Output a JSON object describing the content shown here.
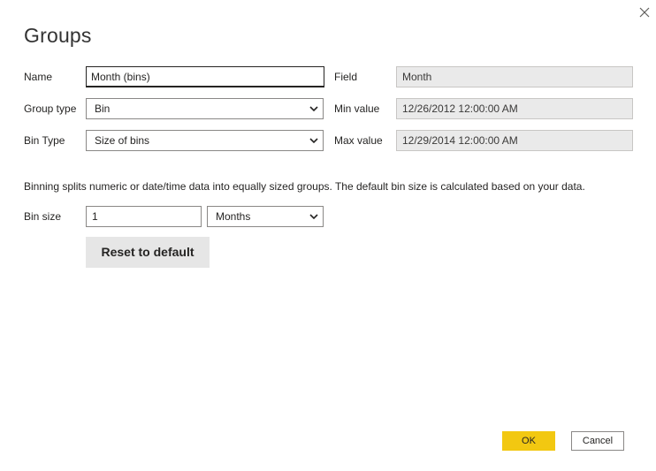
{
  "dialog": {
    "title": "Groups",
    "close_icon": "close-icon"
  },
  "form": {
    "name_label": "Name",
    "name_value": "Month (bins)",
    "group_type_label": "Group type",
    "group_type_value": "Bin",
    "bin_type_label": "Bin Type",
    "bin_type_value": "Size of bins",
    "field_label": "Field",
    "field_value": "Month",
    "min_label": "Min value",
    "min_value": "12/26/2012 12:00:00 AM",
    "max_label": "Max value",
    "max_value": "12/29/2014 12:00:00 AM"
  },
  "binning": {
    "hint": "Binning splits numeric or date/time data into equally sized groups. The default bin size is calculated based on your data.",
    "bin_size_label": "Bin size",
    "bin_size_value": "1",
    "bin_unit_value": "Months",
    "reset_label": "Reset to default"
  },
  "footer": {
    "ok_label": "OK",
    "cancel_label": "Cancel"
  },
  "colors": {
    "accent": "#f2c811",
    "readonly_bg": "#eaeaea",
    "button_bg": "#e6e6e6"
  }
}
